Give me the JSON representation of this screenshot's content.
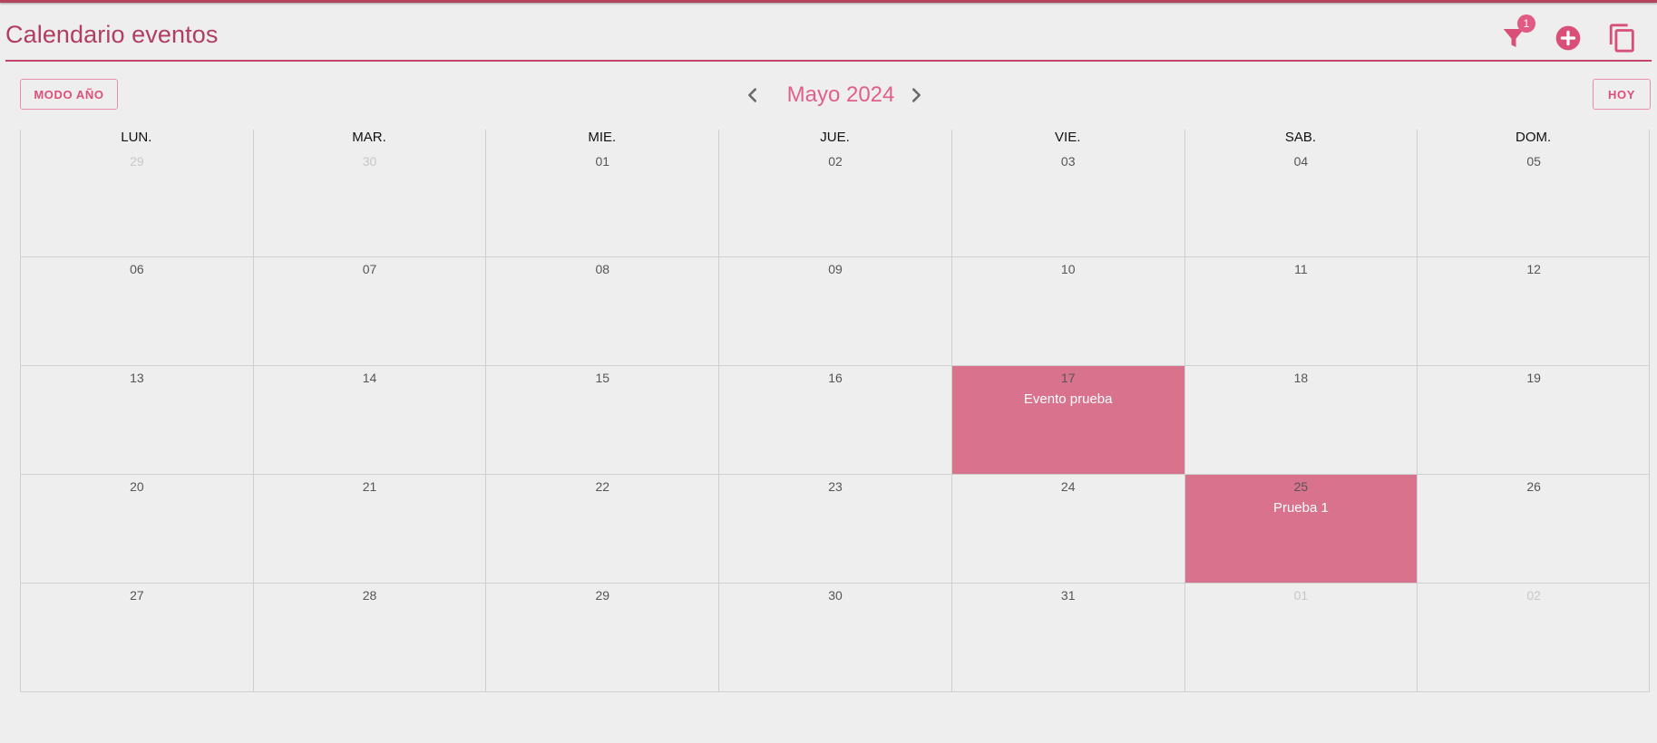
{
  "header": {
    "title": "Calendario eventos",
    "filter_badge": "1",
    "icons": {
      "filter": "filter-icon",
      "add": "add-circle-icon",
      "copy": "copy-icon"
    }
  },
  "toolbar": {
    "year_mode_label": "MODO AÑO",
    "today_label": "HOY",
    "month_title": "Mayo 2024"
  },
  "colors": {
    "accent": "#e0608a",
    "title": "#b03e62",
    "event": "#d9728d",
    "background": "#eeeeee"
  },
  "calendar": {
    "weekdays": [
      "LUN.",
      "MAR.",
      "MIE.",
      "JUE.",
      "VIE.",
      "SAB.",
      "DOM."
    ],
    "weeks": [
      [
        {
          "day": "29",
          "other": true
        },
        {
          "day": "30",
          "other": true
        },
        {
          "day": "01"
        },
        {
          "day": "02"
        },
        {
          "day": "03"
        },
        {
          "day": "04"
        },
        {
          "day": "05"
        }
      ],
      [
        {
          "day": "06"
        },
        {
          "day": "07"
        },
        {
          "day": "08"
        },
        {
          "day": "09"
        },
        {
          "day": "10"
        },
        {
          "day": "11"
        },
        {
          "day": "12"
        }
      ],
      [
        {
          "day": "13"
        },
        {
          "day": "14"
        },
        {
          "day": "15"
        },
        {
          "day": "16"
        },
        {
          "day": "17",
          "event": "Evento prueba"
        },
        {
          "day": "18"
        },
        {
          "day": "19"
        }
      ],
      [
        {
          "day": "20"
        },
        {
          "day": "21"
        },
        {
          "day": "22"
        },
        {
          "day": "23"
        },
        {
          "day": "24"
        },
        {
          "day": "25",
          "event": "Prueba 1"
        },
        {
          "day": "26"
        }
      ],
      [
        {
          "day": "27"
        },
        {
          "day": "28"
        },
        {
          "day": "29"
        },
        {
          "day": "30"
        },
        {
          "day": "31"
        },
        {
          "day": "01",
          "other": true
        },
        {
          "day": "02",
          "other": true
        }
      ]
    ]
  }
}
